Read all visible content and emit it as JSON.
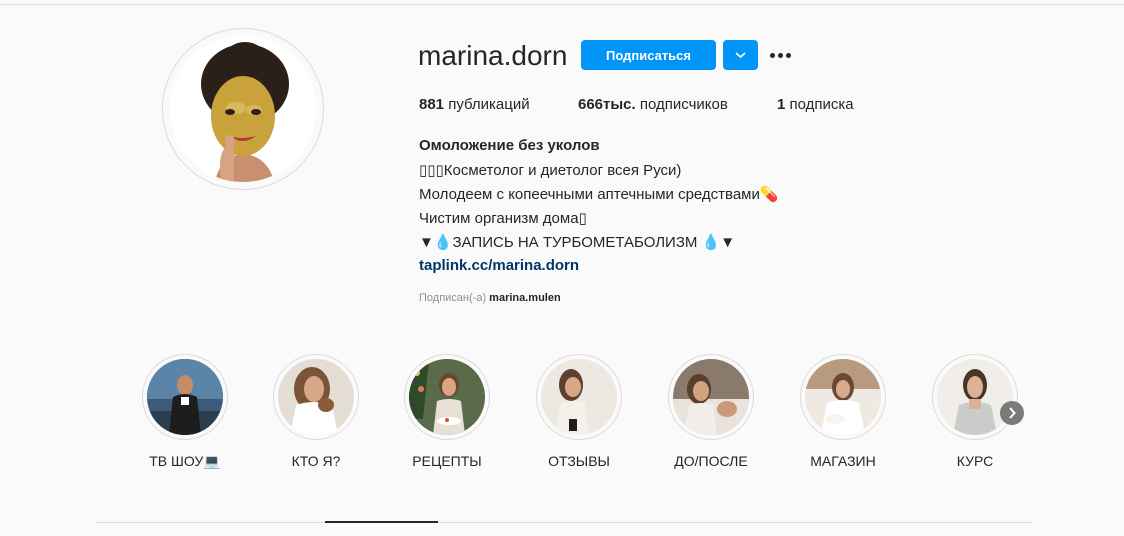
{
  "profile": {
    "username": "marina.dorn",
    "follow_label": "Подписаться",
    "dropdown_icon": "chevron-down-icon",
    "more_icon": "more-options-icon",
    "stats": {
      "posts_count": "881",
      "posts_label": "публикаций",
      "followers_count": "666тыс.",
      "followers_label": "подписчиков",
      "following_count": "1",
      "following_label": "подписка"
    },
    "bio": {
      "name": "Омоложение без уколов",
      "lines": [
        "▯▯▯Косметолог и диетолог всея Руси)",
        "Молодеем с копеечными аптечными средствами💊",
        "Чистим организм дома▯",
        "▼💧ЗАПИСЬ НА ТУРБОМЕТАБОЛИЗМ 💧▼"
      ],
      "link": "taplink.cc/marina.dorn"
    },
    "followed_by": {
      "prefix": "Подписан(-а)",
      "user": "marina.mulen"
    }
  },
  "highlights": [
    {
      "label": "ТВ ШОУ💻",
      "image": "highlight-tv-show-image"
    },
    {
      "label": "КТО Я?",
      "image": "highlight-who-am-i-image"
    },
    {
      "label": "РЕЦЕПТЫ",
      "image": "highlight-recipes-image"
    },
    {
      "label": "ОТЗЫВЫ",
      "image": "highlight-reviews-image"
    },
    {
      "label": "ДО/ПОСЛЕ",
      "image": "highlight-before-after-image"
    },
    {
      "label": "МАГАЗИН",
      "image": "highlight-shop-image"
    },
    {
      "label": "КУРС",
      "image": "highlight-course-image"
    }
  ],
  "highlights_next_icon": "chevron-right-icon",
  "colors": {
    "primary_button": "#0095f6",
    "link": "#00376b",
    "text": "#262626",
    "muted": "#8e8e8e",
    "border": "#dbdbdb",
    "background": "#fafafa"
  }
}
